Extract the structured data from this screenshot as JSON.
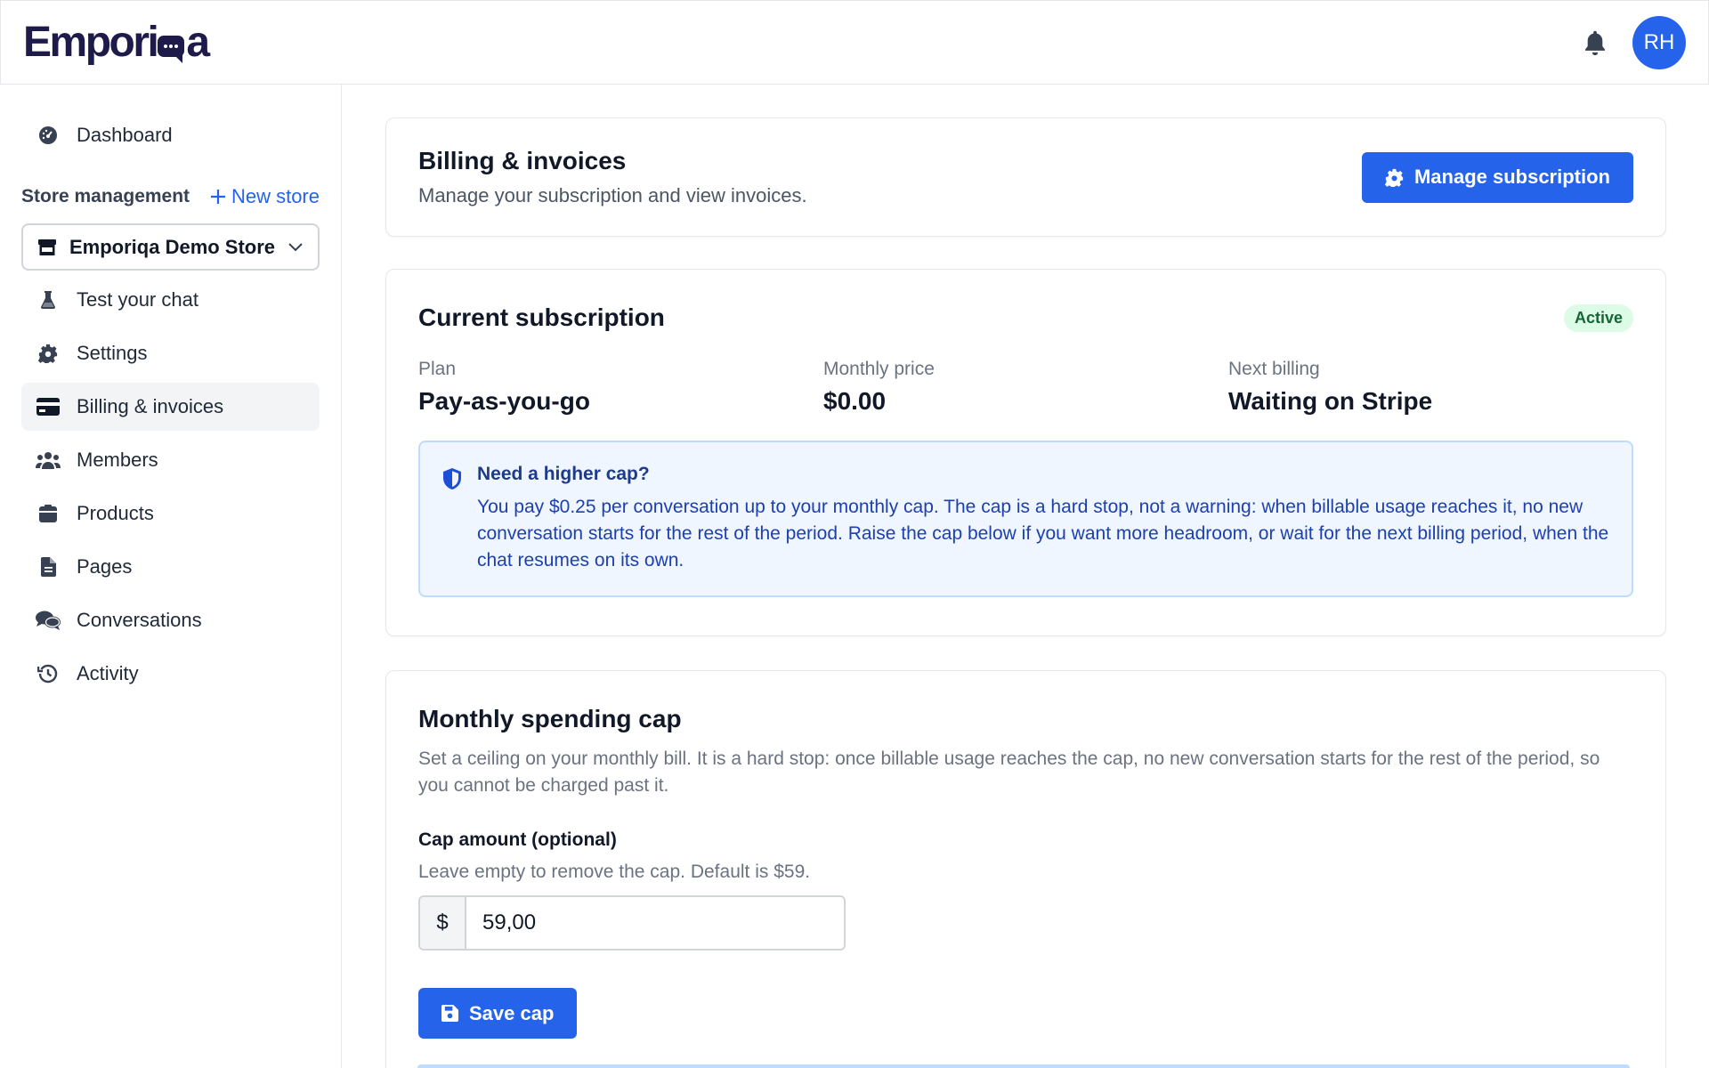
{
  "header": {
    "logo_pre": "Empori",
    "logo_post": "a",
    "avatar_initials": "RH"
  },
  "sidebar": {
    "dashboard": "Dashboard",
    "store_management": "Store management",
    "new_store": "New store",
    "store_selected": "Emporiqa Demo Store",
    "items": [
      {
        "label": "Test your chat",
        "icon": "flask-icon"
      },
      {
        "label": "Settings",
        "icon": "gear-icon"
      },
      {
        "label": "Billing & invoices",
        "icon": "credit-card-icon",
        "active": true
      },
      {
        "label": "Members",
        "icon": "users-icon"
      },
      {
        "label": "Products",
        "icon": "box-icon"
      },
      {
        "label": "Pages",
        "icon": "file-icon"
      },
      {
        "label": "Conversations",
        "icon": "comments-icon"
      },
      {
        "label": "Activity",
        "icon": "history-icon"
      }
    ]
  },
  "page": {
    "title": "Billing & invoices",
    "subtitle": "Manage your subscription and view invoices.",
    "manage_button": "Manage subscription"
  },
  "subscription": {
    "title": "Current subscription",
    "status": "Active",
    "plan_label": "Plan",
    "plan_value": "Pay-as-you-go",
    "price_label": "Monthly price",
    "price_value": "$0.00",
    "next_label": "Next billing",
    "next_value": "Waiting on Stripe",
    "info_title": "Need a higher cap?",
    "info_text": "You pay $0.25 per conversation up to your monthly cap. The cap is a hard stop, not a warning: when billable usage reaches it, no new conversation starts for the rest of the period. Raise the cap below if you want more headroom, or wait for the next billing period, when the chat resumes on its own."
  },
  "cap": {
    "title": "Monthly spending cap",
    "description": "Set a ceiling on your monthly bill. It is a hard stop: once billable usage reaches the cap, no new conversation starts for the rest of the period, so you cannot be charged past it.",
    "field_label": "Cap amount (optional)",
    "field_help": "Leave empty to remove the cap. Default is $59.",
    "currency": "$",
    "value": "59,00",
    "save_button": "Save cap"
  },
  "colors": {
    "accent": "#2563eb",
    "brand": "#1e1b4b",
    "active_badge_bg": "#dcfce7",
    "info_bg": "#eff6ff"
  }
}
